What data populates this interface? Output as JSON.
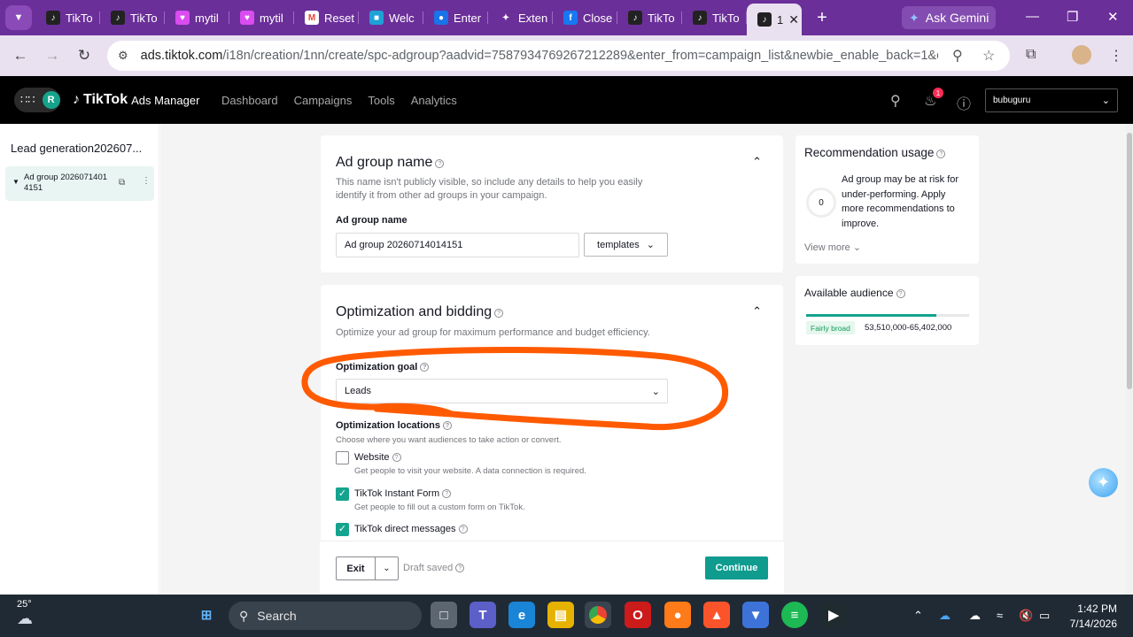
{
  "browser": {
    "tabs": [
      {
        "title": "TikTo",
        "icon": "tiktok-icon"
      },
      {
        "title": "TikTo",
        "icon": "tiktok-icon"
      },
      {
        "title": "mytil",
        "icon": "mytiktok-icon"
      },
      {
        "title": "mytil",
        "icon": "mytiktok-icon"
      },
      {
        "title": "Reset",
        "icon": "gmail-icon"
      },
      {
        "title": "Welc",
        "icon": "welcome-icon"
      },
      {
        "title": "Enter",
        "icon": "enter-icon"
      },
      {
        "title": "Exten",
        "icon": "extension-icon"
      },
      {
        "title": "Close",
        "icon": "facebook-icon"
      },
      {
        "title": "TikTo",
        "icon": "tiktok-icon"
      },
      {
        "title": "TikTo",
        "icon": "tiktok-icon"
      },
      {
        "title": "1",
        "icon": "tiktok-icon",
        "active": true
      }
    ],
    "gemini_label": "Ask Gemini",
    "url_host": "ads.tiktok.com",
    "url_path": "/i18n/creation/1nn/create/spc-adgroup?aadvid=7587934769267212289&enter_from=campaign_list&newbie_enable_back=1&ca..."
  },
  "appbar": {
    "avatar_letter": "R",
    "brand": "TikTok",
    "brand_suffix": "Ads Manager",
    "nav": [
      "Dashboard",
      "Campaigns",
      "Tools",
      "Analytics"
    ],
    "notification_count": "1",
    "account": "bubuguru"
  },
  "sidebar": {
    "campaign": "Lead generation202607...",
    "adgroup_line1": "Ad group 2026071401",
    "adgroup_line2": "4151"
  },
  "adgroup_name_card": {
    "title": "Ad group name",
    "description": "This name isn't publicly visible, so include any details to help you easily identify it from other ad groups in your campaign.",
    "field_label": "Ad group name",
    "value": "Ad group 20260714014151",
    "templates_label": "templates"
  },
  "optimization_card": {
    "title": "Optimization and bidding",
    "description": "Optimize your ad group for maximum performance and budget efficiency.",
    "goal_label": "Optimization goal",
    "goal_value": "Leads",
    "locations_label": "Optimization locations",
    "locations_desc": "Choose where you want audiences to take action or convert.",
    "options": [
      {
        "title": "Website",
        "desc": "Get people to visit your website. A data connection is required.",
        "checked": false
      },
      {
        "title": "TikTok Instant Form",
        "desc": "Get people to fill out a custom form on TikTok.",
        "checked": true
      },
      {
        "title": "TikTok direct messages",
        "desc": "",
        "checked": true
      }
    ]
  },
  "footer": {
    "exit_label": "Exit",
    "draft_label": "Draft saved",
    "continue_label": "Continue"
  },
  "recommendation": {
    "title": "Recommendation usage",
    "count": "0",
    "text": "Ad group may be at risk for under-performing. Apply more recommendations to improve.",
    "view_more": "View more"
  },
  "audience": {
    "title": "Available audience",
    "tag": "Fairly broad",
    "range": "53,510,000-65,402,000",
    "fill_percent": 80
  },
  "taskbar": {
    "temperature": "25°",
    "search_placeholder": "Search",
    "time": "1:42 PM",
    "date": "7/14/2026"
  },
  "colors": {
    "accent": "#0f9b8e",
    "annotation": "#ff5a00",
    "chrome": "#6b2f99"
  }
}
